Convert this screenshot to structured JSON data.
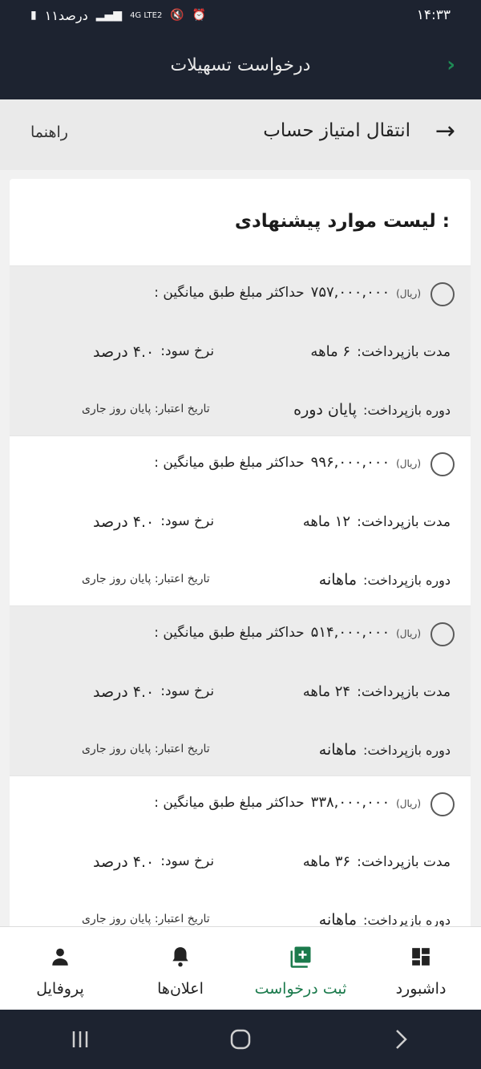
{
  "status_bar": {
    "time": "۱۴:۳۳",
    "battery": "۱۱درصد",
    "network": "4G LTE2"
  },
  "header": {
    "title": "درخواست تسهیلات"
  },
  "subheader": {
    "title": "انتقال امتیاز حساب",
    "guide": "راهنما"
  },
  "list": {
    "title": "لیست موارد پیشنهادی :",
    "max_label": "حداکثر مبلغ طبق میانگین :",
    "currency": "(ریال)",
    "duration_label": "مدت بازپرداخت:",
    "rate_label": "نرخ سود:",
    "period_label": "دوره بازپرداخت:",
    "validity": "تاریخ اعتبار: پایان روز جاری",
    "offers": [
      {
        "amount": "۷۵۷,۰۰۰,۰۰۰",
        "duration": "۶ ماهه",
        "rate": "۴.۰ درصد",
        "period": "پایان دوره"
      },
      {
        "amount": "۹۹۶,۰۰۰,۰۰۰",
        "duration": "۱۲ ماهه",
        "rate": "۴.۰ درصد",
        "period": "ماهانه"
      },
      {
        "amount": "۵۱۴,۰۰۰,۰۰۰",
        "duration": "۲۴ ماهه",
        "rate": "۴.۰ درصد",
        "period": "ماهانه"
      },
      {
        "amount": "۳۳۸,۰۰۰,۰۰۰",
        "duration": "۳۶ ماهه",
        "rate": "۴.۰ درصد",
        "period": "ماهانه"
      }
    ]
  },
  "bottom_nav": {
    "profile": "پروفایل",
    "notifications": "اعلان‌ها",
    "new_request": "ثبت درخواست",
    "dashboard": "داشبورد"
  },
  "colors": {
    "dark": "#1d2330",
    "accent": "#1b7a4c",
    "shaded": "#ececec"
  }
}
